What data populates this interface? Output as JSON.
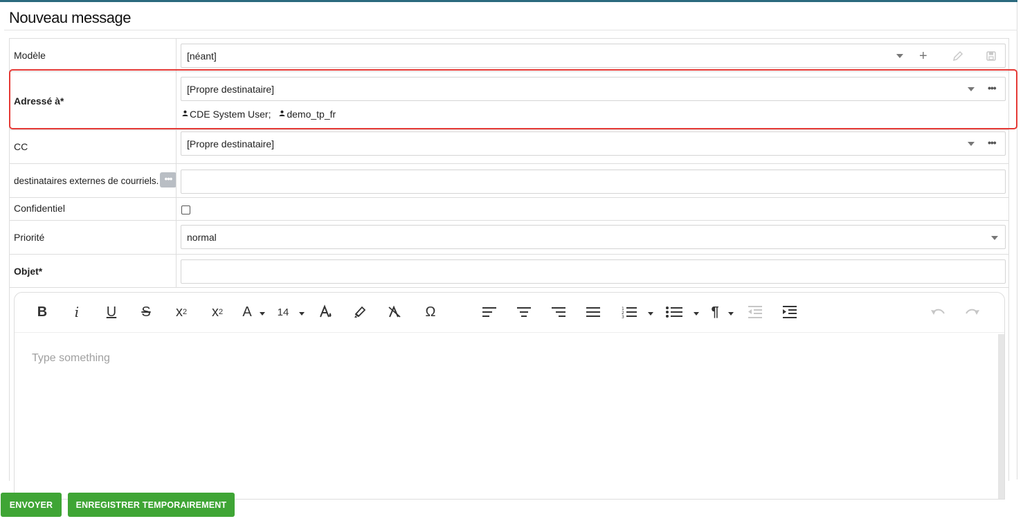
{
  "title": "Nouveau message",
  "form": {
    "modele": {
      "label": "Modèle",
      "value": "[néant]"
    },
    "adresse": {
      "label": "Adressé à*",
      "value": "[Propre destinataire]",
      "recipients": [
        "CDE System User;",
        "demo_tp_fr"
      ]
    },
    "cc": {
      "label": "CC",
      "value": "[Propre destinataire]"
    },
    "externes": {
      "label": "destinataires externes de courriels.",
      "value": ""
    },
    "confidentiel": {
      "label": "Confidentiel",
      "checked": false
    },
    "priorite": {
      "label": "Priorité",
      "value": "normal"
    },
    "objet": {
      "label": "Objet*",
      "value": ""
    }
  },
  "editor": {
    "font_size": "14",
    "placeholder": "Type something",
    "paragraph_glyph": "¶",
    "omega_glyph": "Ω"
  },
  "buttons": {
    "send": "ENVOYER",
    "save_temp": "ENREGISTRER TEMPORAIREMENT"
  },
  "colors": {
    "accent_bar": "#2b6a7e",
    "button_green": "#3fa535",
    "highlight_red": "#e53935"
  }
}
